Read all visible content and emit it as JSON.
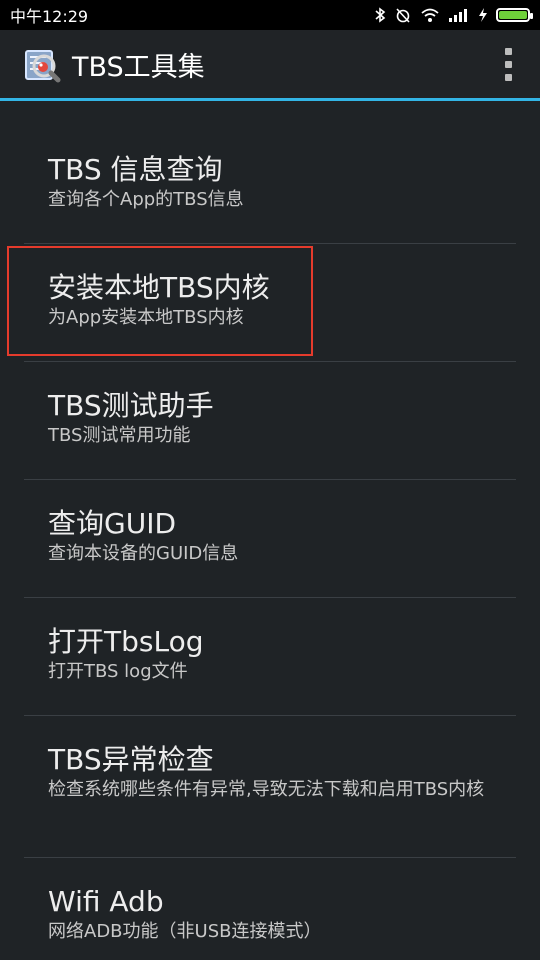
{
  "status": {
    "time": "中午12:29",
    "icons": [
      "bluetooth-icon",
      "alarm-off-icon",
      "wifi-icon",
      "signal-icon",
      "charging-icon",
      "battery-icon"
    ],
    "battery_fill": 1.0,
    "battery_color": "#6fd13a"
  },
  "appbar": {
    "title": "TBS工具集",
    "accent": "#33b5e5"
  },
  "menu": [
    {
      "title": "TBS 信息查询",
      "subtitle": "查询各个App的TBS信息"
    },
    {
      "title": "安装本地TBS内核",
      "subtitle": "为App安装本地TBS内核"
    },
    {
      "title": "TBS测试助手",
      "subtitle": "TBS测试常用功能"
    },
    {
      "title": "查询GUID",
      "subtitle": "查询本设备的GUID信息"
    },
    {
      "title": "打开TbsLog",
      "subtitle": "打开TBS log文件"
    },
    {
      "title": "TBS异常检查",
      "subtitle": "检查系统哪些条件有异常,导致无法下载和启用TBS内核"
    },
    {
      "title": "Wifi Adb",
      "subtitle": "网络ADB功能（非USB连接模式）"
    }
  ],
  "selected_index": 1,
  "selection_color": "#e53b2c"
}
